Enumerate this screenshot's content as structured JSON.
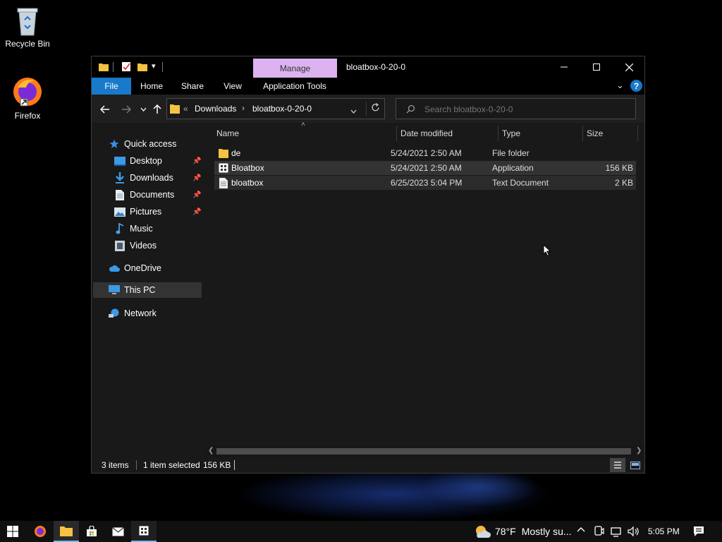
{
  "desktop": {
    "icons": [
      {
        "label": "Recycle Bin"
      },
      {
        "label": "Firefox"
      }
    ]
  },
  "window": {
    "title": "bloatbox-0-20-0",
    "contextual_tab": "Manage",
    "ribbon_tabs": [
      "File",
      "Home",
      "Share",
      "View",
      "Application Tools"
    ],
    "address": {
      "overflow": "«",
      "crumbs": [
        "Downloads",
        "bloatbox-0-20-0"
      ]
    },
    "search": {
      "placeholder": "Search bloatbox-0-20-0"
    },
    "nav": {
      "quick_access": "Quick access",
      "items": [
        "Desktop",
        "Downloads",
        "Documents",
        "Pictures",
        "Music",
        "Videos"
      ],
      "onedrive": "OneDrive",
      "this_pc": "This PC",
      "network": "Network"
    },
    "columns": [
      "Name",
      "Date modified",
      "Type",
      "Size"
    ],
    "files": [
      {
        "name": "de",
        "date": "5/24/2021 2:50 AM",
        "type": "File folder",
        "size": "",
        "icon": "folder-icon"
      },
      {
        "name": "Bloatbox",
        "date": "5/24/2021 2:50 AM",
        "type": "Application",
        "size": "156 KB",
        "icon": "application-icon"
      },
      {
        "name": "bloatbox",
        "date": "6/25/2023 5:04 PM",
        "type": "Text Document",
        "size": "2 KB",
        "icon": "text-document-icon"
      }
    ],
    "status": {
      "count": "3 items",
      "selection": "1 item selected",
      "size": "156 KB"
    }
  },
  "taskbar": {
    "weather_temp": "78°F",
    "weather_text": "Mostly su...",
    "time": "5:05 PM"
  },
  "colors": {
    "accent": "#1979ca",
    "manage_tab": "#dcb2f0",
    "folder": "#f5c242",
    "window_bg": "#191919"
  }
}
